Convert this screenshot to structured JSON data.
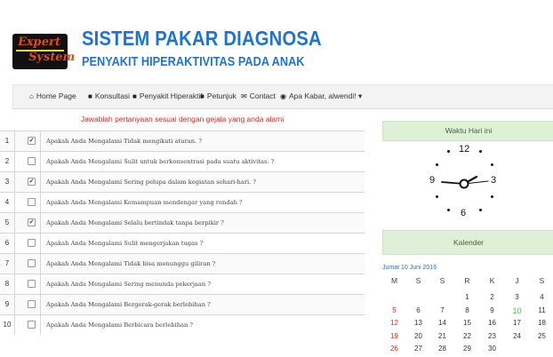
{
  "header": {
    "logo_line1": "Expert",
    "logo_line2": "System",
    "title": "SISTEM PAKAR DIAGNOSA",
    "subtitle": "PENYAKIT HIPERAKTIVITAS PADA ANAK"
  },
  "nav": {
    "items": [
      {
        "label": "Home Page",
        "icon": "home-icon",
        "glyph": "⌂"
      },
      {
        "label": "Konsultasi",
        "icon": "book-icon",
        "glyph": "■"
      },
      {
        "label": "Penyakit Hiperaktif",
        "icon": "book-icon",
        "glyph": "■"
      },
      {
        "label": "Petunjuk",
        "icon": "book-icon",
        "glyph": "■"
      },
      {
        "label": "Contact",
        "icon": "envelope-icon",
        "glyph": "✉"
      },
      {
        "label": "Apa Kabar, alwendi! ▾",
        "icon": "globe-icon",
        "glyph": "◉"
      }
    ]
  },
  "questions": {
    "heading": "Jawablah pertanyaan sesuai dengan gejala yang anda alami",
    "rows": [
      {
        "num": "1",
        "checked": true,
        "text": "Apakah Anda Mengalami Tidak mengikuti aturan. ?"
      },
      {
        "num": "2",
        "checked": false,
        "text": "Apakah Anda Mengalami Sulit untuk berkonsentrasi pada suatu aktivitas. ?"
      },
      {
        "num": "3",
        "checked": true,
        "text": "Apakah Anda Mengalami Sering pelupa dalam kegiatan sehari-hari. ?"
      },
      {
        "num": "4",
        "checked": false,
        "text": "Apakah Anda Mengalami Kemampuan mendengar yang rendah ?"
      },
      {
        "num": "5",
        "checked": true,
        "text": "Apakah Anda Mengalami Selalu bertindak tanpa berpikir ?"
      },
      {
        "num": "6",
        "checked": false,
        "text": "Apakah Anda Mengalami Sulit mengerjakan tugas ?"
      },
      {
        "num": "7",
        "checked": false,
        "text": "Apakah Anda Mengalami Tidak bisa menunggu giliran ?"
      },
      {
        "num": "8",
        "checked": false,
        "text": "Apakah Anda Mengalami Sering menunda pekerjaan ?"
      },
      {
        "num": "9",
        "checked": false,
        "text": "Apakah Anda Mengalami Bergerak-gerak berlebihan ?"
      },
      {
        "num": "10",
        "checked": false,
        "text": "Apakah Anda Mengalami Berbicara berlebihan ?"
      }
    ]
  },
  "clock_panel": {
    "heading": "Waktu Hari ini",
    "n12": "12",
    "n3": "3",
    "n6": "6",
    "n9": "9"
  },
  "calendar": {
    "heading": "Kalender",
    "date_title": "Jumat 10 Juni 2016",
    "days": [
      "M",
      "S",
      "S",
      "R",
      "K",
      "J",
      "S"
    ],
    "weeks": [
      [
        "",
        "",
        "",
        "1",
        "2",
        "3",
        "4"
      ],
      [
        "5",
        "6",
        "7",
        "8",
        "9",
        "10",
        "11"
      ],
      [
        "12",
        "13",
        "14",
        "15",
        "16",
        "17",
        "18"
      ],
      [
        "19",
        "20",
        "21",
        "22",
        "23",
        "24",
        "25"
      ],
      [
        "26",
        "27",
        "28",
        "29",
        "30",
        "",
        ""
      ]
    ],
    "today": "10",
    "colors": {
      "sunday": "#d9281d",
      "today": "#3fc73f"
    }
  }
}
